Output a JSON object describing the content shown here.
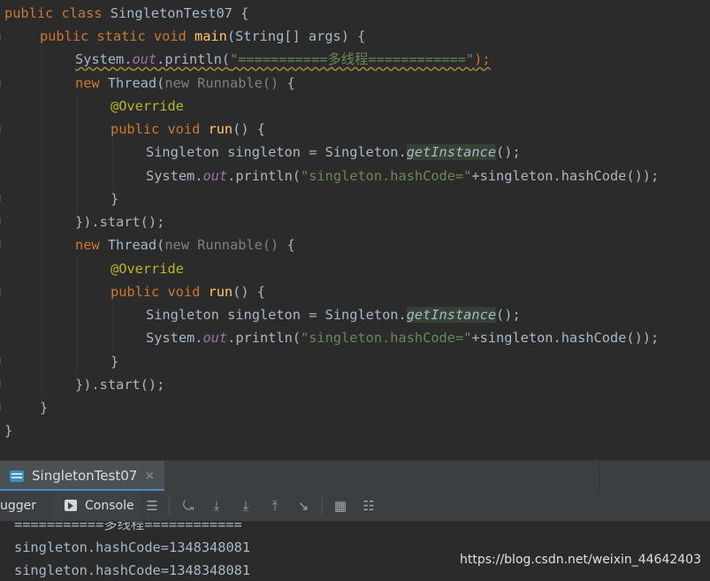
{
  "code": {
    "l1": {
      "kw": "public class ",
      "name": "SingletonTest07 {"
    },
    "l2": {
      "kw": "public static void ",
      "fn": "main",
      "rest": "(String[] args) {"
    },
    "l3": {
      "a": "System.",
      "fld": "out",
      "b": ".println(",
      "str": "\"===========多线程============\"",
      "c": ");"
    },
    "l4": {
      "kw": "new ",
      "a": "Thread(",
      "gray": "new Runnable()",
      "b": " {"
    },
    "l5": {
      "ann": "@Override"
    },
    "l6": {
      "kw": "public void ",
      "fn": "run",
      "rest": "() {"
    },
    "l7": {
      "a": "Singleton singleton = Singleton.",
      "it": "getInstance",
      "b": "();"
    },
    "l8": {
      "a": "System.",
      "fld": "out",
      "b": ".println(",
      "str": "\"singleton.hashCode=\"",
      "c": "+singleton.hashCode());"
    },
    "l9": {
      "a": "}"
    },
    "l10": {
      "a": "}).start();"
    },
    "l11": {
      "kw": "new ",
      "a": "Thread(",
      "gray": "new Runnable()",
      "b": " {"
    },
    "l12": {
      "ann": "@Override"
    },
    "l13": {
      "kw": "public void ",
      "fn": "run",
      "rest": "() {"
    },
    "l14": {
      "a": "Singleton singleton = Singleton.",
      "it": "getInstance",
      "b": "();"
    },
    "l15": {
      "a": "System.",
      "fld": "out",
      "b": ".println(",
      "str": "\"singleton.hashCode=\"",
      "c": "+singleton.hashCode());"
    },
    "l16": {
      "a": "}"
    },
    "l17": {
      "a": "}).start();"
    },
    "l18": {
      "a": "}"
    },
    "l19": {
      "a": "}"
    }
  },
  "run_tab": {
    "label": "SingletonTest07",
    "close": "×"
  },
  "toolbar": {
    "debugger_label": "ugger",
    "console_label": "Console"
  },
  "console": {
    "lines": [
      "===========多线程============",
      "singleton.hashCode=1348348081",
      "singleton.hashCode=1348348081"
    ]
  },
  "watermark": "https://blog.csdn.net/weixin_44642403"
}
